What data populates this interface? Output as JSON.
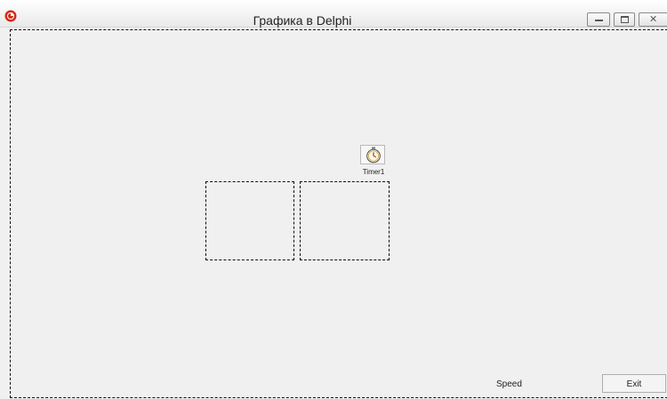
{
  "window": {
    "title": "Графика в Delphi",
    "icon": "delphi-logo-icon",
    "controls": [
      "minimize-icon",
      "maximize-icon",
      "close-icon"
    ]
  },
  "form": {
    "timer_label": "Timer1",
    "timer_icon": "stopwatch-icon",
    "speed_label": "Speed",
    "exit_label": "Exit"
  },
  "colors": {
    "form_background": "#f0f0f0",
    "logo_red": "#d42a1b",
    "outline": "#111111"
  }
}
